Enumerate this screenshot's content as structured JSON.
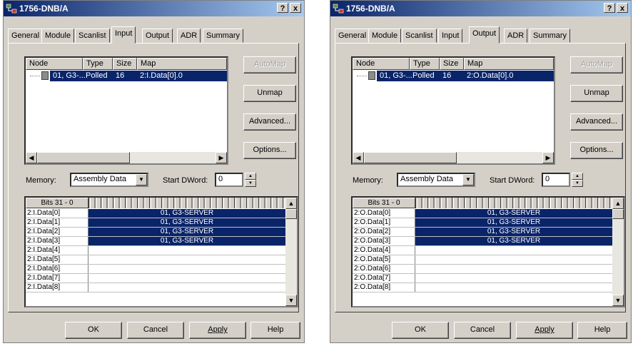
{
  "dialogs": [
    {
      "title": "1756-DNB/A",
      "help_label": "?",
      "close_label": "x",
      "tabs": [
        "General",
        "Module",
        "Scanlist",
        "Input",
        "Output",
        "ADR",
        "Summary"
      ],
      "active_tab": "Input",
      "list_columns": [
        "Node",
        "Type",
        "Size",
        "Map"
      ],
      "list_rows": [
        {
          "node": "01, G3-...",
          "type": "Polled",
          "size": "16",
          "map": "2:I.Data[0].0"
        }
      ],
      "buttons": {
        "automap": "AutoMap",
        "unmap": "Unmap",
        "advanced": "Advanced...",
        "options": "Options..."
      },
      "memory_label": "Memory:",
      "memory_value": "Assembly Data",
      "start_dword_label": "Start DWord:",
      "start_dword_value": "0",
      "bits_header": "Bits 31 - 0",
      "grid_rows": [
        {
          "name": "2:I.Data[0]",
          "value": "01, G3-SERVER"
        },
        {
          "name": "2:I.Data[1]",
          "value": "01, G3-SERVER"
        },
        {
          "name": "2:I.Data[2]",
          "value": "01, G3-SERVER"
        },
        {
          "name": "2:I.Data[3]",
          "value": "01, G3-SERVER"
        },
        {
          "name": "2:I.Data[4]",
          "value": ""
        },
        {
          "name": "2:I.Data[5]",
          "value": ""
        },
        {
          "name": "2:I.Data[6]",
          "value": ""
        },
        {
          "name": "2:I.Data[7]",
          "value": ""
        },
        {
          "name": "2:I.Data[8]",
          "value": ""
        }
      ],
      "footer": {
        "ok": "OK",
        "cancel": "Cancel",
        "apply": "Apply",
        "help": "Help"
      }
    },
    {
      "title": "1756-DNB/A",
      "help_label": "?",
      "close_label": "x",
      "tabs": [
        "General",
        "Module",
        "Scanlist",
        "Input",
        "Output",
        "ADR",
        "Summary"
      ],
      "active_tab": "Output",
      "list_columns": [
        "Node",
        "Type",
        "Size",
        "Map"
      ],
      "list_rows": [
        {
          "node": "01, G3-...",
          "type": "Polled",
          "size": "16",
          "map": "2:O.Data[0].0"
        }
      ],
      "buttons": {
        "automap": "AutoMap",
        "unmap": "Unmap",
        "advanced": "Advanced...",
        "options": "Options..."
      },
      "memory_label": "Memory:",
      "memory_value": "Assembly Data",
      "start_dword_label": "Start DWord:",
      "start_dword_value": "0",
      "bits_header": "Bits 31 - 0",
      "grid_rows": [
        {
          "name": "2:O.Data[0]",
          "value": "01, G3-SERVER"
        },
        {
          "name": "2:O.Data[1]",
          "value": "01, G3-SERVER"
        },
        {
          "name": "2:O.Data[2]",
          "value": "01, G3-SERVER"
        },
        {
          "name": "2:O.Data[3]",
          "value": "01, G3-SERVER"
        },
        {
          "name": "2:O.Data[4]",
          "value": ""
        },
        {
          "name": "2:O.Data[5]",
          "value": ""
        },
        {
          "name": "2:O.Data[6]",
          "value": ""
        },
        {
          "name": "2:O.Data[7]",
          "value": ""
        },
        {
          "name": "2:O.Data[8]",
          "value": ""
        }
      ],
      "footer": {
        "ok": "OK",
        "cancel": "Cancel",
        "apply": "Apply",
        "help": "Help"
      }
    }
  ],
  "colors": {
    "selection": "#0a246a",
    "face": "#d4d0c8",
    "title_start": "#0a246a",
    "title_end": "#a6caf0"
  }
}
